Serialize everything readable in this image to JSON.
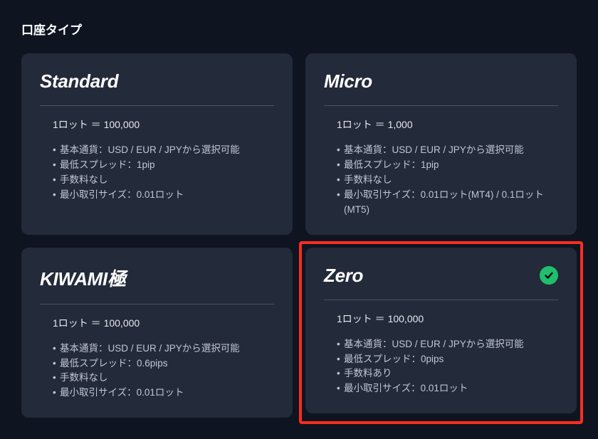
{
  "title": "口座タイプ",
  "cards": [
    {
      "name": "Standard",
      "lot": "1ロット ＝ 100,000",
      "bullets": [
        "基本通貨：USD / EUR / JPYから選択可能",
        "最低スプレッド：1pip",
        "手数料なし",
        "最小取引サイズ：0.01ロット"
      ],
      "selected": false,
      "highlighted": false
    },
    {
      "name": "Micro",
      "lot": "1ロット ＝ 1,000",
      "bullets": [
        "基本通貨：USD / EUR / JPYから選択可能",
        "最低スプレッド：1pip",
        "手数料なし",
        "最小取引サイズ：0.01ロット(MT4) / 0.1ロット(MT5)"
      ],
      "selected": false,
      "highlighted": false
    },
    {
      "name": "KIWAMI極",
      "lot": "1ロット ＝ 100,000",
      "bullets": [
        "基本通貨：USD / EUR / JPYから選択可能",
        "最低スプレッド：0.6pips",
        "手数料なし",
        "最小取引サイズ：0.01ロット"
      ],
      "selected": false,
      "highlighted": false
    },
    {
      "name": "Zero",
      "lot": "1ロット ＝ 100,000",
      "bullets": [
        "基本通貨：USD / EUR / JPYから選択可能",
        "最低スプレッド：0pips",
        "手数料あり",
        "最小取引サイズ：0.01ロット"
      ],
      "selected": true,
      "highlighted": true
    }
  ]
}
